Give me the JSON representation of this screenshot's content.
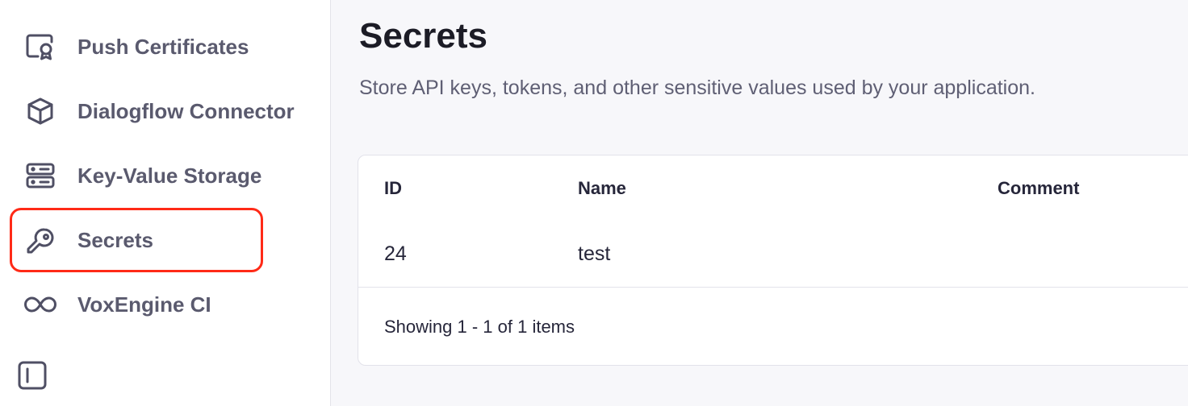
{
  "sidebar": {
    "items": [
      {
        "label": "Push Certificates",
        "icon": "certificate-icon"
      },
      {
        "label": "Dialogflow Connector",
        "icon": "cube-icon"
      },
      {
        "label": "Key-Value Storage",
        "icon": "server-icon"
      },
      {
        "label": "Secrets",
        "icon": "key-icon",
        "highlighted": true
      },
      {
        "label": "VoxEngine CI",
        "icon": "infinity-icon"
      }
    ],
    "collapse_icon": "sidebar-collapse-icon"
  },
  "main": {
    "title": "Secrets",
    "description": "Store API keys, tokens, and other sensitive values used by your application.",
    "table": {
      "columns": [
        "ID",
        "Name",
        "Comment"
      ],
      "rows": [
        {
          "id": "24",
          "name": "test",
          "comment": ""
        }
      ],
      "pagination": "Showing 1 - 1 of 1 items"
    }
  },
  "colors": {
    "highlight_border": "#ff2a17",
    "nav_text": "#5a5a6e",
    "background": "#f7f7fa"
  }
}
